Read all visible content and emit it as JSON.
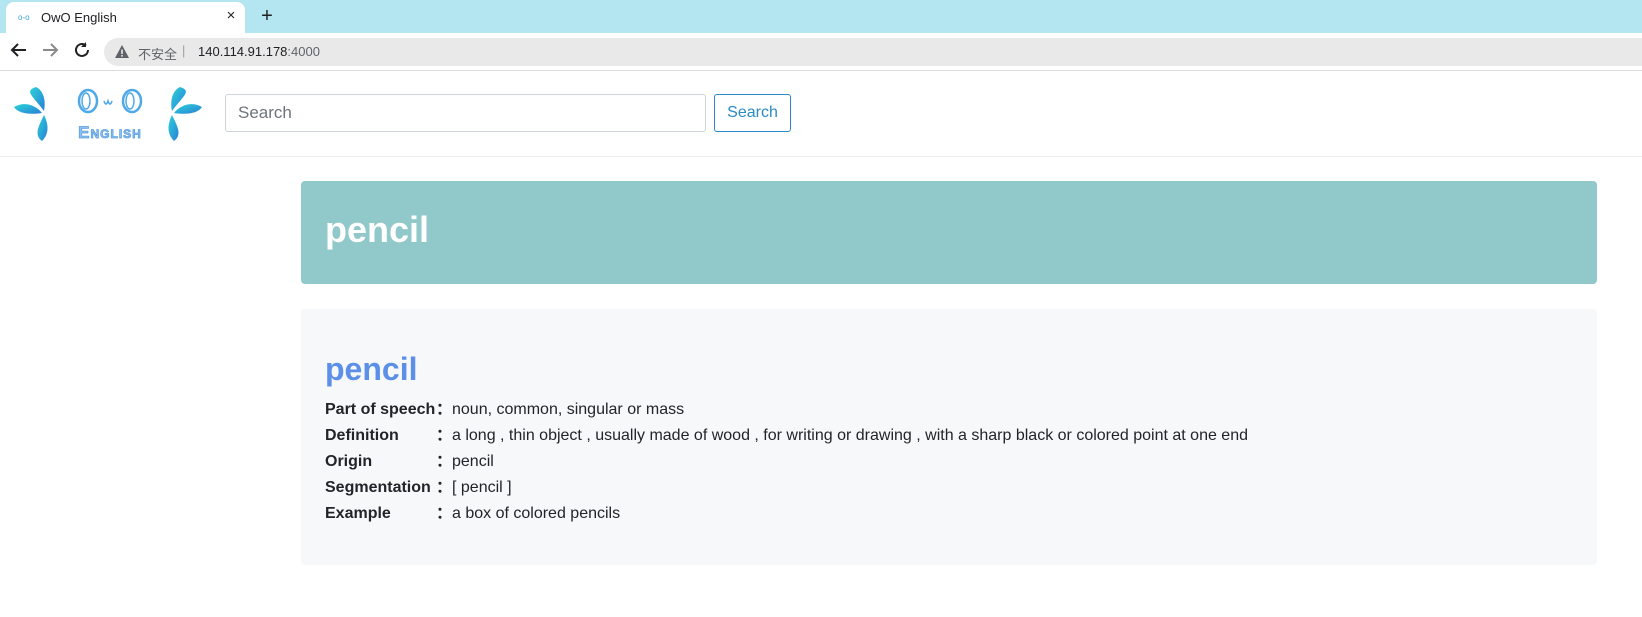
{
  "browser": {
    "tab_title": "OwO English",
    "tab_favicon": "o-o",
    "tab_close": "×",
    "new_tab": "+",
    "security_label": "不安全",
    "separator": "|",
    "url_host": "140.114.91.178",
    "url_port": ":4000"
  },
  "site": {
    "logo": {
      "top_text": "O w O",
      "bottom_text": "English",
      "colors": {
        "leaf_start": "#2bd3d8",
        "leaf_end": "#2a7fd6",
        "text": "#4fa8e8"
      }
    },
    "search": {
      "placeholder": "Search",
      "button_label": "Search"
    }
  },
  "hero": {
    "title": "pencil",
    "background": "#91c8c9"
  },
  "entry": {
    "word": "pencil",
    "word_color": "#5b8fe8",
    "rows": [
      {
        "label": "Part of speech",
        "colon": "：",
        "value": "noun, common, singular or mass"
      },
      {
        "label": "Definition",
        "colon": "：",
        "value": "a long , thin object , usually made of wood , for writing or drawing , with a sharp black or colored point at one end"
      },
      {
        "label": "Origin",
        "colon": "：",
        "value": "pencil"
      },
      {
        "label": "Segmentation",
        "colon": "：",
        "value": "[ pencil ]"
      },
      {
        "label": "Example",
        "colon": "：",
        "value": "a box of colored pencils"
      }
    ]
  }
}
